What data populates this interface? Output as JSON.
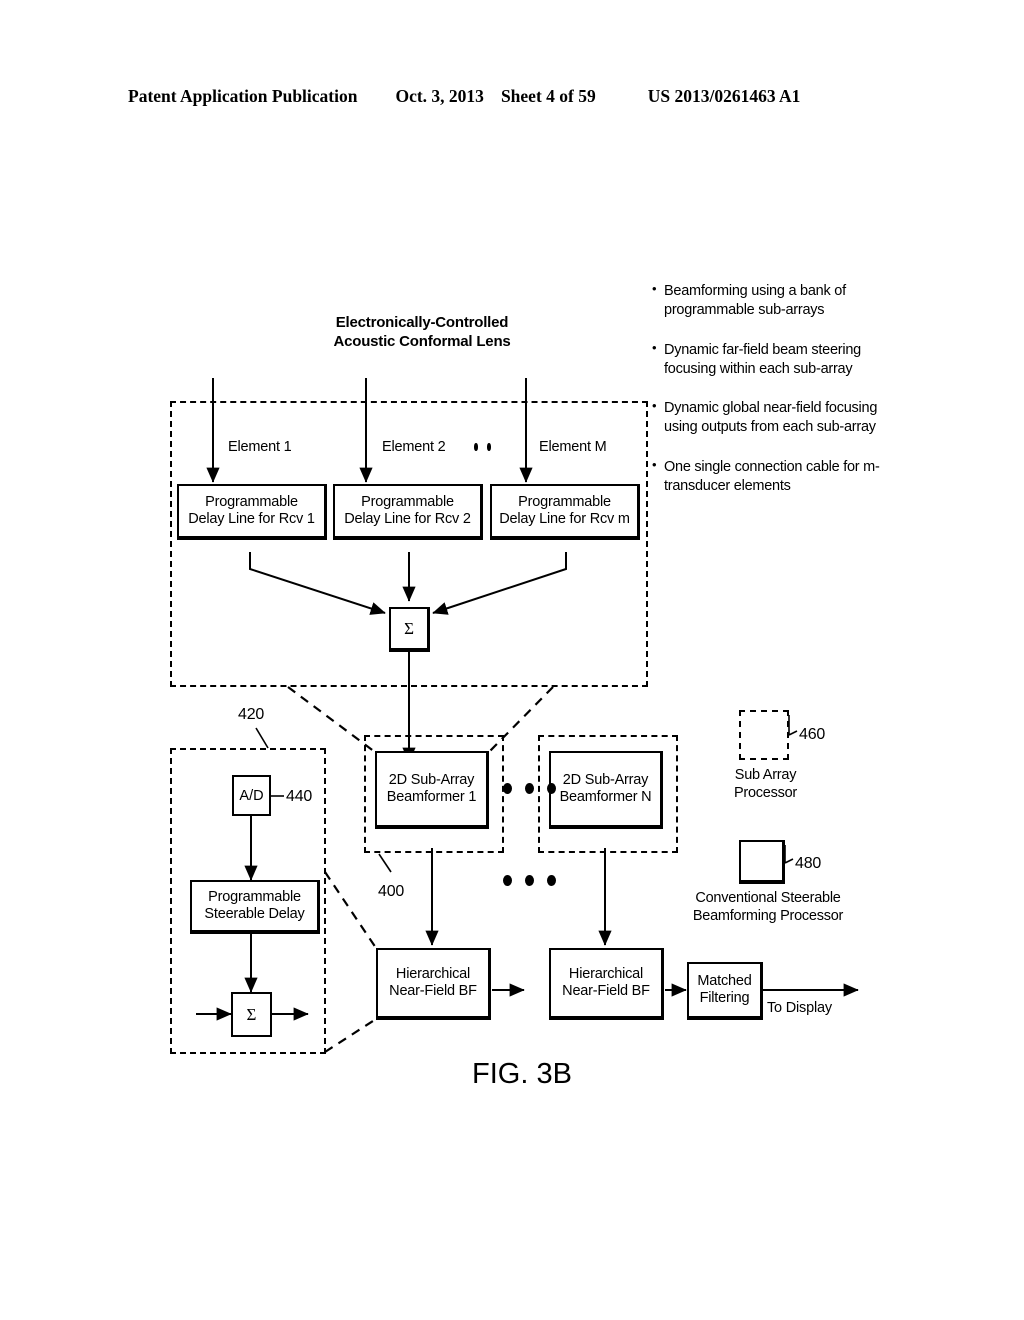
{
  "header": {
    "publication": "Patent Application Publication",
    "date": "Oct. 3, 2013",
    "sheet": "Sheet 4 of 59",
    "patent_number": "US 2013/0261463 A1"
  },
  "figure": {
    "caption": "FIG. 3B",
    "lens_title_line1": "Electronically-Controlled",
    "lens_title_line2": "Acoustic Conformal Lens"
  },
  "elements": [
    {
      "label": "Element 1"
    },
    {
      "label": "Element 2"
    },
    {
      "label": "Element M"
    }
  ],
  "delay_lines": [
    {
      "line1": "Programmable",
      "line2": "Delay Line for Rcv 1"
    },
    {
      "line1": "Programmable",
      "line2": "Delay Line for Rcv 2"
    },
    {
      "line1": "Programmable",
      "line2": "Delay Line for Rcv m"
    }
  ],
  "summation": {
    "symbol_top": "Σ",
    "symbol_bottom": "Σ"
  },
  "bullets": [
    "Beamforming using a bank of programmable sub-arrays",
    "Dynamic far-field beam steering focusing within each sub-array",
    "Dynamic global near-field focusing using outputs from each sub-array",
    "One single connection cable for m-transducer elements"
  ],
  "left_detail": {
    "ref_420": "420",
    "ad_label": "A/D",
    "ref_440": "440",
    "steerable_line1": "Programmable",
    "steerable_line2": "Steerable Delay"
  },
  "subarrays": [
    {
      "line1": "2D Sub-Array",
      "line2": "Beamformer 1"
    },
    {
      "line1": "2D Sub-Array",
      "line2": "Beamformer N"
    }
  ],
  "ref_400": "400",
  "near_field": [
    {
      "line1": "Hierarchical",
      "line2": "Near-Field BF"
    },
    {
      "line1": "Hierarchical",
      "line2": "Near-Field BF"
    }
  ],
  "matched_filtering": {
    "line1": "Matched",
    "line2": "Filtering"
  },
  "to_display": "To Display",
  "legend": {
    "sub_array": {
      "ref": "460",
      "line1": "Sub Array",
      "line2": "Processor"
    },
    "conventional": {
      "ref": "480",
      "line1": "Conventional Steerable",
      "line2": "Beamforming Processor"
    }
  },
  "colors": {
    "ink": "#000000",
    "paper": "#ffffff"
  }
}
